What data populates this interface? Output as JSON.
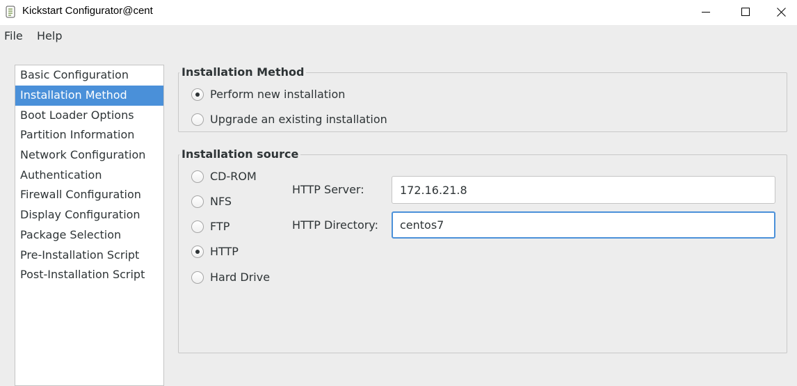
{
  "window": {
    "title": "Kickstart Configurator@cent",
    "icon": "app-icon"
  },
  "menu": {
    "file": "File",
    "help": "Help"
  },
  "nav": {
    "selected_index": 1,
    "items": [
      {
        "label": "Basic Configuration"
      },
      {
        "label": "Installation Method"
      },
      {
        "label": "Boot Loader Options"
      },
      {
        "label": "Partition Information"
      },
      {
        "label": "Network Configuration"
      },
      {
        "label": "Authentication"
      },
      {
        "label": "Firewall Configuration"
      },
      {
        "label": "Display Configuration"
      },
      {
        "label": "Package Selection"
      },
      {
        "label": "Pre-Installation Script"
      },
      {
        "label": "Post-Installation Script"
      }
    ]
  },
  "installation_method": {
    "legend": "Installation Method",
    "options": [
      {
        "label": "Perform new installation",
        "checked": true
      },
      {
        "label": "Upgrade an existing installation",
        "checked": false
      }
    ]
  },
  "installation_source": {
    "legend": "Installation source",
    "options": [
      {
        "label": "CD-ROM",
        "checked": false
      },
      {
        "label": "NFS",
        "checked": false
      },
      {
        "label": "FTP",
        "checked": false
      },
      {
        "label": "HTTP",
        "checked": true
      },
      {
        "label": "Hard Drive",
        "checked": false
      }
    ],
    "http_server_label": "HTTP Server:",
    "http_server_value": "172.16.21.8",
    "http_directory_label": "HTTP Directory:",
    "http_directory_value": "centos7"
  },
  "colors": {
    "selection": "#4a90d9",
    "background": "#ededed"
  }
}
